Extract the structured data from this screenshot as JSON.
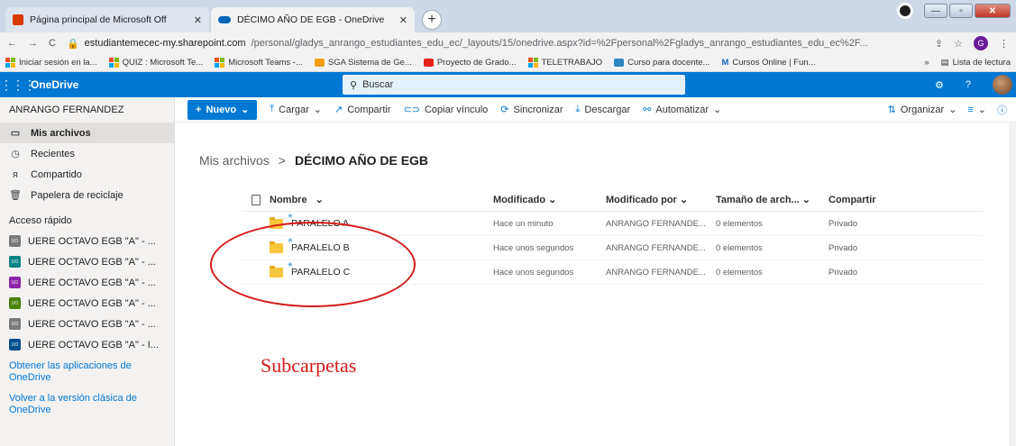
{
  "browser": {
    "tabs": [
      {
        "title": "Página principal de Microsoft Off",
        "active": false
      },
      {
        "title": "DÉCIMO AÑO DE EGB - OneDrive",
        "active": true
      }
    ],
    "new_tab_label": "+",
    "url_host": "estudiantemecec-my.sharepoint.com",
    "url_path": "/personal/gladys_anrango_estudiantes_edu_ec/_layouts/15/onedrive.aspx?id=%2Fpersonal%2Fgladys_anrango_estudiantes_edu_ec%2F...",
    "profile_initial": "G",
    "bookmarks": [
      {
        "label": "Iniciar sesión en la...",
        "icon": "ms-icon"
      },
      {
        "label": "QUIZ : Microsoft Te...",
        "icon": "ms-icon"
      },
      {
        "label": "Microsoft Teams -...",
        "icon": "ms-icon"
      },
      {
        "label": "SGA Sistema de Ge...",
        "icon": "sga-icon"
      },
      {
        "label": "Proyecto de Grado...",
        "icon": "youtube-icon"
      },
      {
        "label": "TELETRABAJO",
        "icon": "ms-icon"
      },
      {
        "label": "Curso para docente...",
        "icon": "course-icon"
      },
      {
        "label": "Cursos Online | Fun...",
        "icon": "cursos-icon"
      }
    ],
    "reading_list": "Lista de lectura",
    "more_bookmarks": "»"
  },
  "onedrive": {
    "app_name": "OneDrive",
    "search_placeholder": "Buscar"
  },
  "sidebar": {
    "user_name": "ANRANGO FERNANDEZ",
    "nav": [
      {
        "label": "Mis archivos",
        "icon": "folder-icon",
        "selected": true
      },
      {
        "label": "Recientes",
        "icon": "clock-icon",
        "selected": false
      },
      {
        "label": "Compartido",
        "icon": "people-icon",
        "selected": false
      },
      {
        "label": "Papelera de reciclaje",
        "icon": "trash-icon",
        "selected": false
      }
    ],
    "quick_access_title": "Acceso rápido",
    "quick_access": [
      {
        "label": "UERE OCTAVO EGB \"A\" - ...",
        "abbr": "UO",
        "color": "#7a7a7a"
      },
      {
        "label": "UERE OCTAVO EGB \"A\" - ...",
        "abbr": "UO",
        "color": "#038387"
      },
      {
        "label": "UERE OCTAVO EGB \"A\" - ...",
        "abbr": "UO",
        "color": "#8e24aa"
      },
      {
        "label": "UERE OCTAVO EGB \"A\" - ...",
        "abbr": "UO",
        "color": "#498205"
      },
      {
        "label": "UERE OCTAVO EGB \"A\" - ...",
        "abbr": "UO",
        "color": "#7a7a7a"
      },
      {
        "label": "UERE OCTAVO EGB \"A\" - I...",
        "abbr": "UO",
        "color": "#004e8c"
      }
    ],
    "link_apps": "Obtener las aplicaciones de OneDrive",
    "link_classic": "Volver a la versión clásica de OneDrive"
  },
  "commands": {
    "nuevo": "Nuevo",
    "cargar": "Cargar",
    "compartir": "Compartir",
    "copiar": "Copiar vínculo",
    "sincronizar": "Sincronizar",
    "descargar": "Descargar",
    "automatizar": "Automatizar",
    "organizar": "Organizar"
  },
  "breadcrumb": {
    "root": "Mis archivos",
    "separator": ">",
    "current": "DÉCIMO AÑO DE EGB"
  },
  "table": {
    "headers": {
      "name": "Nombre",
      "modified": "Modificado",
      "modified_by": "Modificado por",
      "size": "Tamaño de arch...",
      "sharing": "Compartir"
    },
    "rows": [
      {
        "name": "PARALELO A",
        "modified": "Hace un minuto",
        "modified_by": "ANRANGO FERNANDE...",
        "size": "0 elementos",
        "sharing": "Privado"
      },
      {
        "name": "PARALELO B",
        "modified": "Hace unos segundos",
        "modified_by": "ANRANGO FERNANDE...",
        "size": "0 elementos",
        "sharing": "Privado"
      },
      {
        "name": "PARALELO C",
        "modified": "Hace unos segundos",
        "modified_by": "ANRANGO FERNANDE...",
        "size": "0 elementos",
        "sharing": "Privado"
      }
    ]
  },
  "annotation": {
    "text": "Subcarpetas",
    "color": "#d51b1b"
  }
}
